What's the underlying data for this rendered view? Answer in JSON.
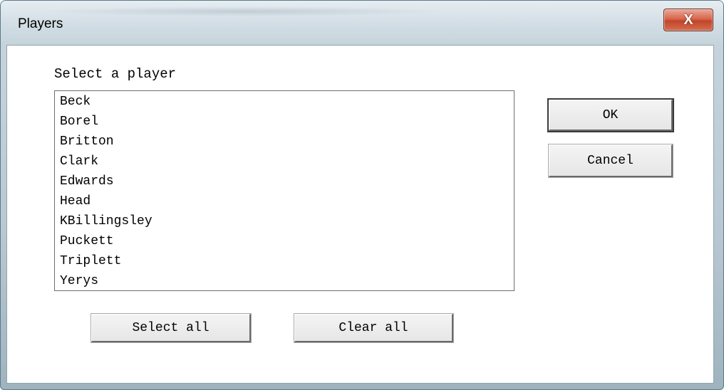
{
  "window": {
    "title": "Players",
    "close_glyph": "X"
  },
  "dialog": {
    "prompt": "Select a player",
    "players": [
      "Beck",
      "Borel",
      "Britton",
      "Clark",
      "Edwards",
      "Head",
      "KBillingsley",
      "Puckett",
      "Triplett",
      "Yerys"
    ],
    "ok_label": "OK",
    "cancel_label": "Cancel",
    "select_all_label": "Select all",
    "clear_all_label": "Clear all"
  },
  "colors": {
    "close_button": "#d8664c",
    "titlebar": "#d4dfe6",
    "client_bg": "#ffffff"
  },
  "icons": {
    "close": "close-icon"
  }
}
